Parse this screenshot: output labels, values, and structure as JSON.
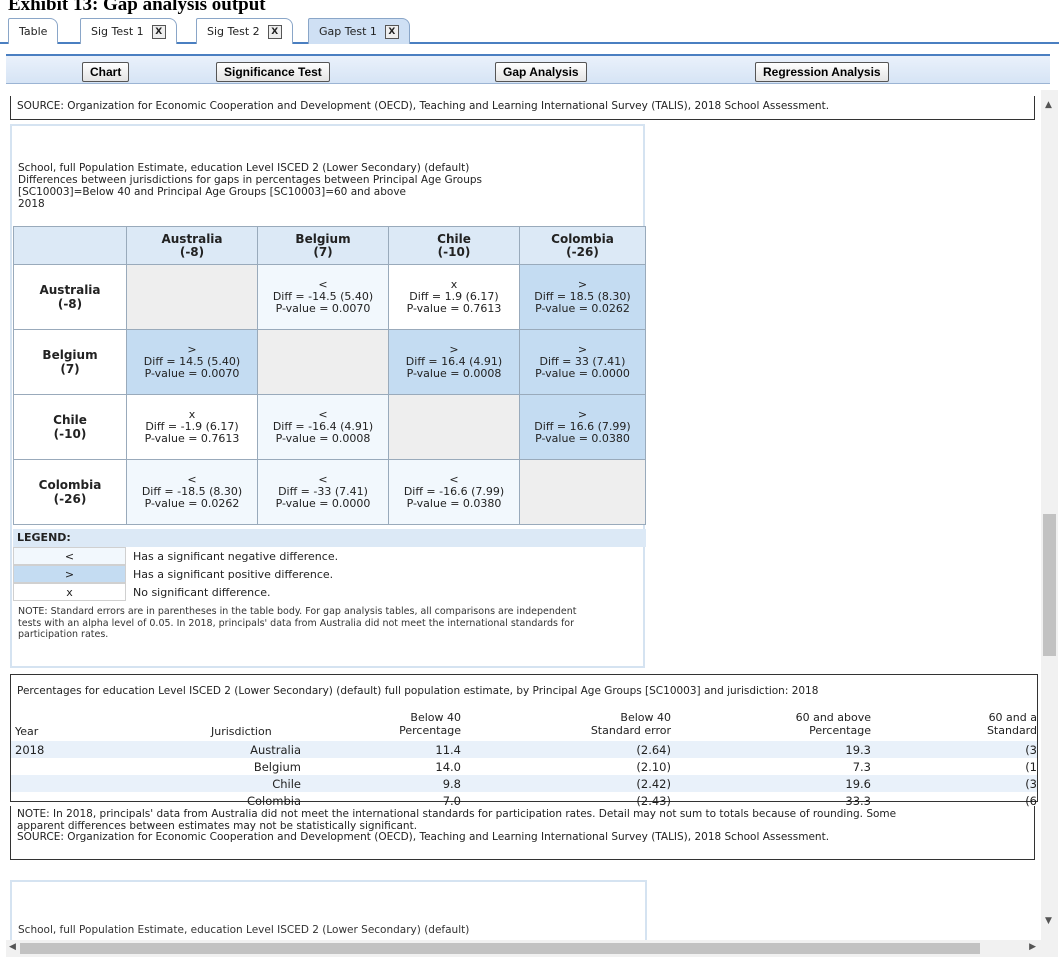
{
  "exhibit_title": "Exhibit 13: Gap analysis output",
  "tabs": [
    {
      "label": "Table",
      "closable": false,
      "active": false
    },
    {
      "label": "Sig Test 1",
      "closable": true,
      "active": false
    },
    {
      "label": "Sig Test 2",
      "closable": true,
      "active": false
    },
    {
      "label": "Gap Test 1",
      "closable": true,
      "active": true
    }
  ],
  "close_glyph": "X",
  "toolbar": {
    "chart": "Chart",
    "significance": "Significance Test",
    "gap": "Gap Analysis",
    "regression": "Regression Analysis"
  },
  "source_top": "SOURCE: Organization for Economic Cooperation and Development (OECD), Teaching and Learning International Survey (TALIS), 2018 School Assessment.",
  "gap_table": {
    "title_lines": [
      "School, full Population Estimate, education Level ISCED 2 (Lower Secondary) (default)",
      "Differences between jurisdictions for gaps in percentages between Principal Age Groups",
      "[SC10003]=Below 40 and Principal Age Groups [SC10003]=60 and above",
      "2018"
    ],
    "columns": [
      {
        "name": "Australia",
        "gap": "(-8)"
      },
      {
        "name": "Belgium",
        "gap": "(7)"
      },
      {
        "name": "Chile",
        "gap": "(-10)"
      },
      {
        "name": "Colombia",
        "gap": "(-26)"
      }
    ],
    "rows": [
      {
        "name": "Australia",
        "gap": "(-8)",
        "cells": [
          null,
          {
            "sym": "<",
            "diff": "Diff = -14.5 (5.40)",
            "p": "P-value = 0.0070",
            "kind": "neg"
          },
          {
            "sym": "x",
            "diff": "Diff = 1.9 (6.17)",
            "p": "P-value = 0.7613",
            "kind": "ns"
          },
          {
            "sym": ">",
            "diff": "Diff = 18.5 (8.30)",
            "p": "P-value = 0.0262",
            "kind": "pos"
          }
        ]
      },
      {
        "name": "Belgium",
        "gap": "(7)",
        "cells": [
          {
            "sym": ">",
            "diff": "Diff = 14.5 (5.40)",
            "p": "P-value = 0.0070",
            "kind": "pos"
          },
          null,
          {
            "sym": ">",
            "diff": "Diff = 16.4 (4.91)",
            "p": "P-value = 0.0008",
            "kind": "pos"
          },
          {
            "sym": ">",
            "diff": "Diff = 33 (7.41)",
            "p": "P-value = 0.0000",
            "kind": "pos"
          }
        ]
      },
      {
        "name": "Chile",
        "gap": "(-10)",
        "cells": [
          {
            "sym": "x",
            "diff": "Diff = -1.9 (6.17)",
            "p": "P-value = 0.7613",
            "kind": "ns"
          },
          {
            "sym": "<",
            "diff": "Diff = -16.4 (4.91)",
            "p": "P-value = 0.0008",
            "kind": "neg"
          },
          null,
          {
            "sym": ">",
            "diff": "Diff = 16.6 (7.99)",
            "p": "P-value = 0.0380",
            "kind": "pos"
          }
        ]
      },
      {
        "name": "Colombia",
        "gap": "(-26)",
        "cells": [
          {
            "sym": "<",
            "diff": "Diff = -18.5 (8.30)",
            "p": "P-value = 0.0262",
            "kind": "neg"
          },
          {
            "sym": "<",
            "diff": "Diff = -33 (7.41)",
            "p": "P-value = 0.0000",
            "kind": "neg"
          },
          {
            "sym": "<",
            "diff": "Diff = -16.6 (7.99)",
            "p": "P-value = 0.0380",
            "kind": "neg"
          },
          null
        ]
      }
    ],
    "legend_title": "LEGEND:",
    "legend": [
      {
        "sym": "<",
        "text": "Has a significant negative difference.",
        "color": "#f2f8fd"
      },
      {
        "sym": ">",
        "text": "Has a significant positive difference.",
        "color": "#c4dcf2"
      },
      {
        "sym": "x",
        "text": "No significant difference.",
        "color": "#ffffff"
      }
    ],
    "note": "NOTE: Standard errors are in parentheses in the table body. For gap analysis tables, all comparisons are independent tests with an alpha level of 0.05. In 2018, principals' data from Australia did not meet the international standards for participation rates."
  },
  "pct_table": {
    "caption": "Percentages for education Level ISCED 2 (Lower Secondary) (default) full population estimate, by Principal Age Groups [SC10003] and jurisdiction: 2018",
    "headers": {
      "year": "Year",
      "jurisdiction": "Jurisdiction",
      "c1_top": "Below 40",
      "c1_bot": "Percentage",
      "c2_top": "Below 40",
      "c2_bot": "Standard error",
      "c3_top": "60 and above",
      "c3_bot": "Percentage",
      "c4_top": "60 and a",
      "c4_bot": "Standard"
    },
    "rows": [
      {
        "year": "2018",
        "jur": "Australia",
        "p1": "11.4",
        "se1": "(2.64)",
        "p2": "19.3",
        "se2": "(3"
      },
      {
        "year": "",
        "jur": "Belgium",
        "p1": "14.0",
        "se1": "(2.10)",
        "p2": "7.3",
        "se2": "(1"
      },
      {
        "year": "",
        "jur": "Chile",
        "p1": "9.8",
        "se1": "(2.42)",
        "p2": "19.6",
        "se2": "(3"
      },
      {
        "year": "",
        "jur": "Colombia",
        "p1": "7.0",
        "se1": "(2.43)",
        "p2": "33.3",
        "se2": "(6"
      }
    ],
    "note_lines": [
      "NOTE: In 2018, principals' data from Australia did not meet the international standards for participation rates. Detail may not sum to totals because of rounding. Some",
      "apparent differences between estimates may not be statistically significant.",
      "SOURCE: Organization for Economic Cooperation and Development (OECD), Teaching and Learning International Survey (TALIS), 2018 School Assessment."
    ]
  },
  "next_panel_text": "School, full Population Estimate, education Level ISCED 2 (Lower Secondary) (default)",
  "scroll_glyphs": {
    "up": "▲",
    "down": "▼",
    "left": "◀",
    "right": "▶"
  }
}
